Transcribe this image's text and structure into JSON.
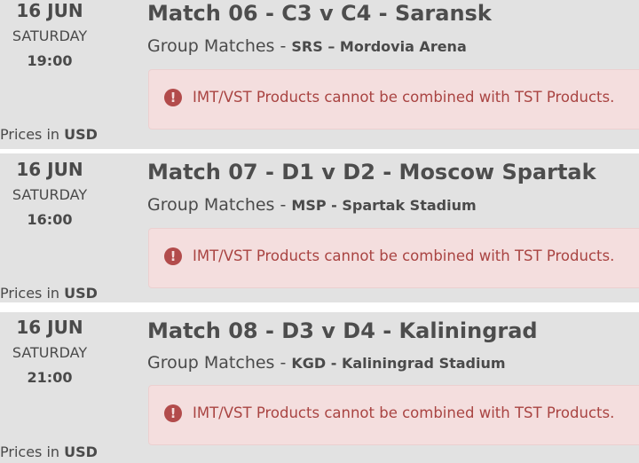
{
  "currency_prefix": "Prices in",
  "currency": "USD",
  "alert_icon": "exclamation-circle-icon",
  "colors": {
    "row_background": "#e2e2e2",
    "alert_background": "#f4dede",
    "alert_text": "#a94442"
  },
  "matches": [
    {
      "date": "16 JUN",
      "weekday": "SATURDAY",
      "time": "19:00",
      "title": "Match 06 - C3 v C4 - Saransk",
      "stage": "Group Matches",
      "venue": "SRS – Mordovia Arena",
      "alert": "IMT/VST Products cannot be combined with TST Products."
    },
    {
      "date": "16 JUN",
      "weekday": "SATURDAY",
      "time": "16:00",
      "title": "Match 07 - D1 v D2 - Moscow Spartak",
      "stage": "Group Matches",
      "venue": "MSP - Spartak Stadium",
      "alert": "IMT/VST Products cannot be combined with TST Products."
    },
    {
      "date": "16 JUN",
      "weekday": "SATURDAY",
      "time": "21:00",
      "title": "Match 08 - D3 v D4 - Kaliningrad",
      "stage": "Group Matches",
      "venue": "KGD - Kaliningrad Stadium",
      "alert": "IMT/VST Products cannot be combined with TST Products."
    }
  ]
}
